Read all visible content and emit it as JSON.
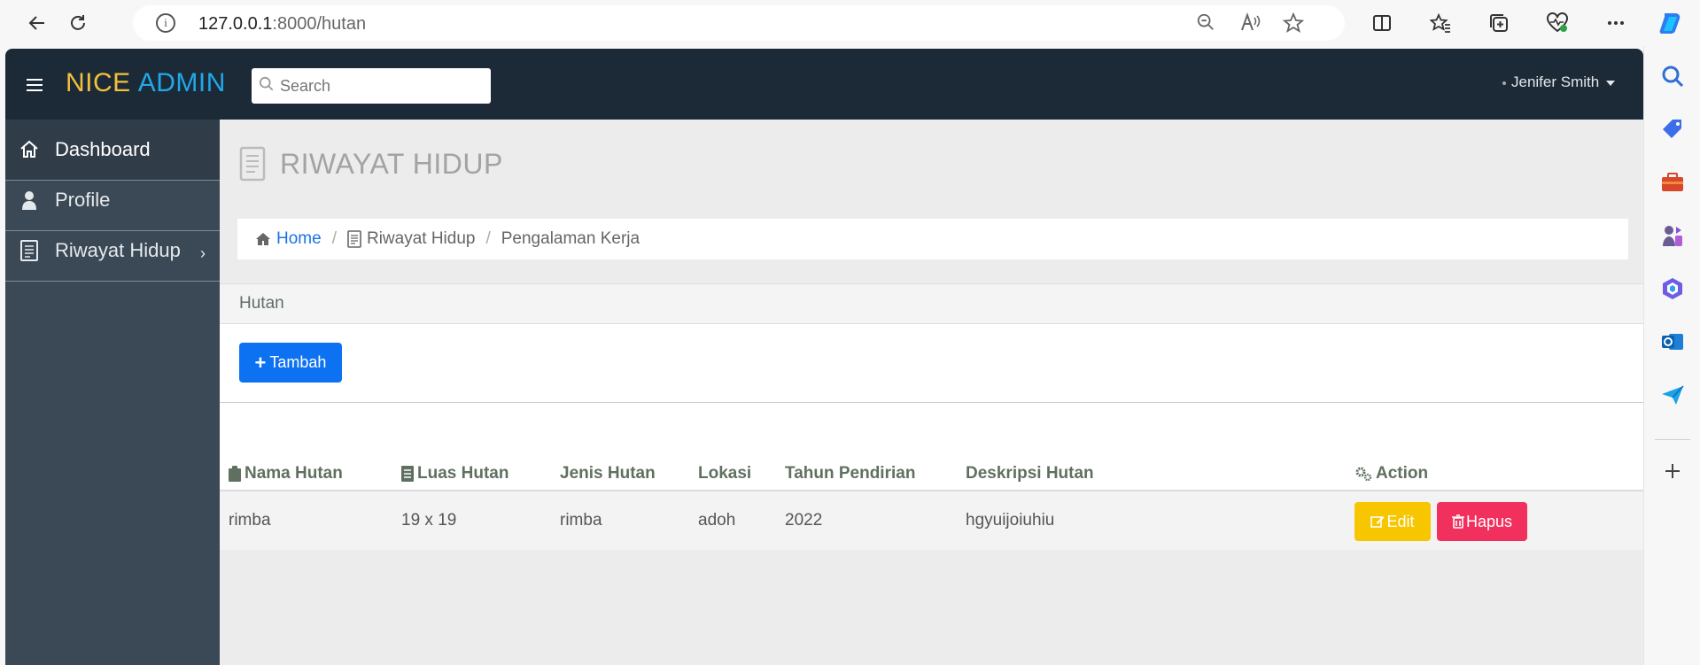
{
  "browser": {
    "url_host": "127.0.0.1",
    "url_rest": ":8000/hutan"
  },
  "app": {
    "logo_part1": "NICE",
    "logo_part2": "ADMIN",
    "search_placeholder": "Search",
    "user_name": "Jenifer Smith"
  },
  "sidebar": {
    "items": [
      {
        "label": "Dashboard",
        "icon": "home-icon"
      },
      {
        "label": "Profile",
        "icon": "user-icon"
      },
      {
        "label": "Riwayat Hidup",
        "icon": "document-icon",
        "chevron": "›"
      }
    ]
  },
  "page": {
    "title": "RIWAYAT HIDUP",
    "breadcrumb": [
      "Home",
      "Riwayat Hidup",
      "Pengalaman Kerja"
    ],
    "panel_title": "Hutan",
    "add_button": "Tambah"
  },
  "table": {
    "headers": [
      "Nama Hutan",
      "Luas Hutan",
      "Jenis Hutan",
      "Lokasi",
      "Tahun Pendirian",
      "Deskripsi Hutan",
      "Action"
    ],
    "rows": [
      {
        "nama": "rimba",
        "luas": "19 x 19",
        "jenis": "rimba",
        "lokasi": "adoh",
        "tahun": "2022",
        "deskripsi": "hgyuijoiuhiu"
      }
    ],
    "edit_label": "Edit",
    "delete_label": "Hapus"
  },
  "colors": {
    "topbar": "#1c2a38",
    "sidebar": "#3b4956",
    "accent_blue": "#0d72f2",
    "edit_yellow": "#f7c600",
    "delete_red": "#f2305e"
  }
}
